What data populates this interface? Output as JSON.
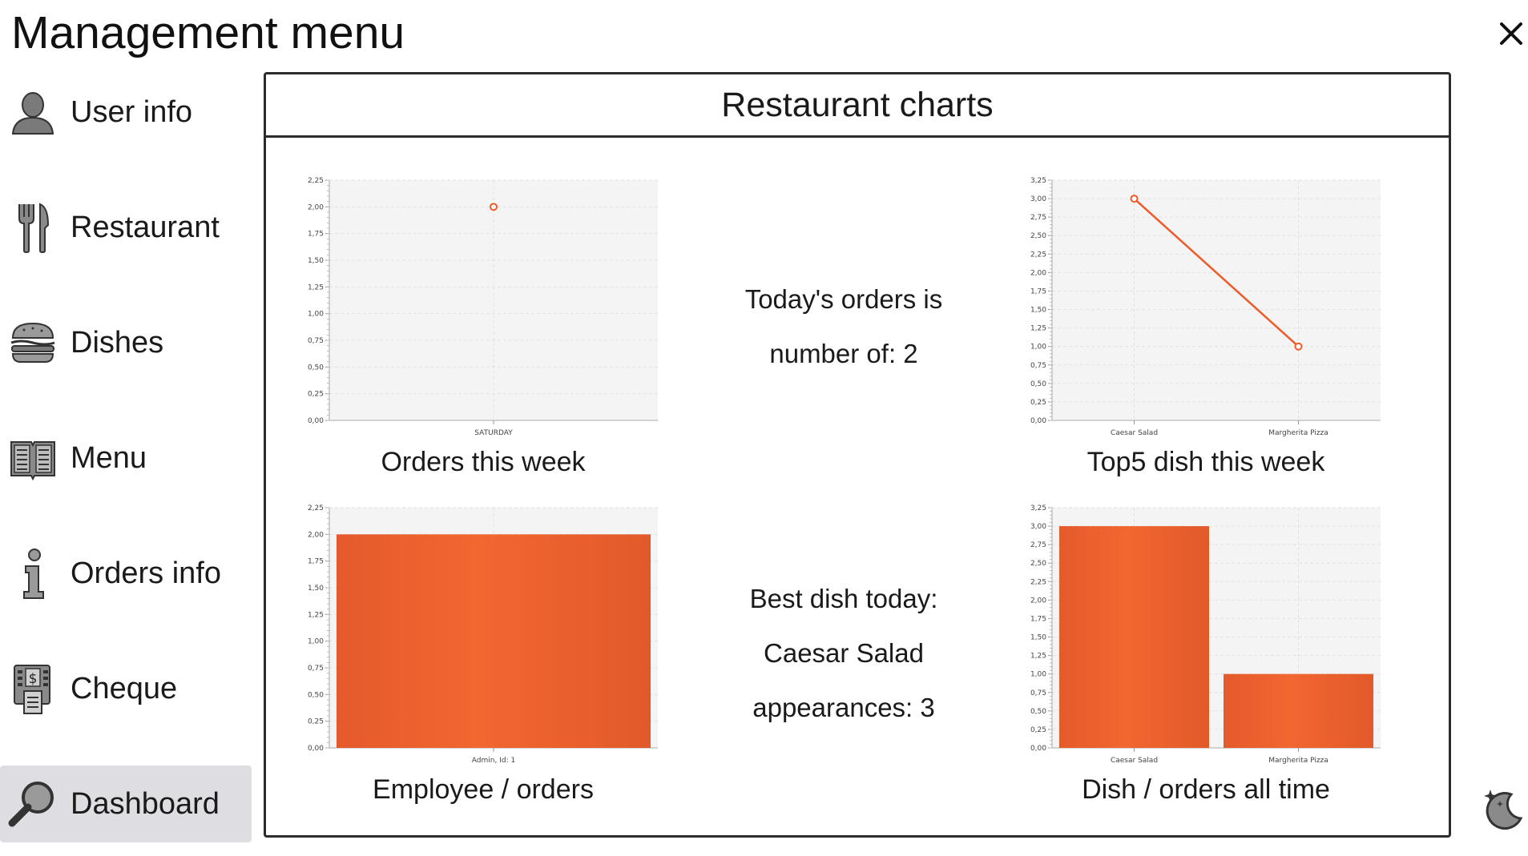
{
  "app": {
    "title": "Management menu"
  },
  "sidebar": {
    "items": [
      {
        "label": "User info",
        "icon": "user-icon",
        "active": false
      },
      {
        "label": "Restaurant",
        "icon": "fork-knife-icon",
        "active": false
      },
      {
        "label": "Dishes",
        "icon": "burger-icon",
        "active": false
      },
      {
        "label": "Menu",
        "icon": "book-icon",
        "active": false
      },
      {
        "label": "Orders info",
        "icon": "info-icon",
        "active": false
      },
      {
        "label": "Cheque",
        "icon": "receipt-icon",
        "active": false
      },
      {
        "label": "Dashboard",
        "icon": "magnifier-icon",
        "active": true
      }
    ]
  },
  "panel": {
    "title": "Restaurant charts",
    "today_orders": {
      "line1": "Today's orders is",
      "line2": "number of: 2"
    },
    "best_dish": {
      "line1": "Best dish today:",
      "line2": "Caesar Salad",
      "line3": "appearances: 3"
    }
  },
  "colors": {
    "accent": "#f05a28",
    "plot_bg": "#f4f4f4",
    "grid": "#e2e2e2",
    "border": "#2c2c2c",
    "active_item_bg": "#dedee2"
  },
  "chart_data": [
    {
      "id": "orders_week",
      "type": "line",
      "caption": "Orders this week",
      "categories": [
        "SATURDAY"
      ],
      "series": [
        {
          "values": [
            2
          ]
        }
      ],
      "ylim": [
        0,
        2.25
      ],
      "yticks": [
        "0,00",
        "0,25",
        "0,50",
        "0,75",
        "1,00",
        "1,25",
        "1,50",
        "1,75",
        "2,00",
        "2,25"
      ],
      "grid": true
    },
    {
      "id": "top5_dish_week",
      "type": "line",
      "caption": "Top5 dish this week",
      "categories": [
        "Caesar Salad",
        "Margherita Pizza"
      ],
      "series": [
        {
          "values": [
            3,
            1
          ]
        }
      ],
      "ylim": [
        0,
        3.25
      ],
      "yticks": [
        "0,00",
        "0,25",
        "0,50",
        "0,75",
        "1,00",
        "1,25",
        "1,50",
        "1,75",
        "2,00",
        "2,25",
        "2,50",
        "2,75",
        "3,00",
        "3,25"
      ],
      "grid": true
    },
    {
      "id": "employee_orders",
      "type": "bar",
      "caption": "Employee / orders",
      "categories": [
        "Admin, Id: 1"
      ],
      "series": [
        {
          "values": [
            2
          ]
        }
      ],
      "ylim": [
        0,
        2.25
      ],
      "yticks": [
        "0,00",
        "0,25",
        "0,50",
        "0,75",
        "1,00",
        "1,25",
        "1,50",
        "1,75",
        "2,00",
        "2,25"
      ],
      "grid": true
    },
    {
      "id": "dish_orders_all_time",
      "type": "bar",
      "caption": "Dish / orders all time",
      "categories": [
        "Caesar Salad",
        "Margherita Pizza"
      ],
      "series": [
        {
          "values": [
            3,
            1
          ]
        }
      ],
      "ylim": [
        0,
        3.25
      ],
      "yticks": [
        "0,00",
        "0,25",
        "0,50",
        "0,75",
        "1,00",
        "1,25",
        "1,50",
        "1,75",
        "2,00",
        "2,25",
        "2,50",
        "2,75",
        "3,00",
        "3,25"
      ],
      "grid": true
    }
  ]
}
